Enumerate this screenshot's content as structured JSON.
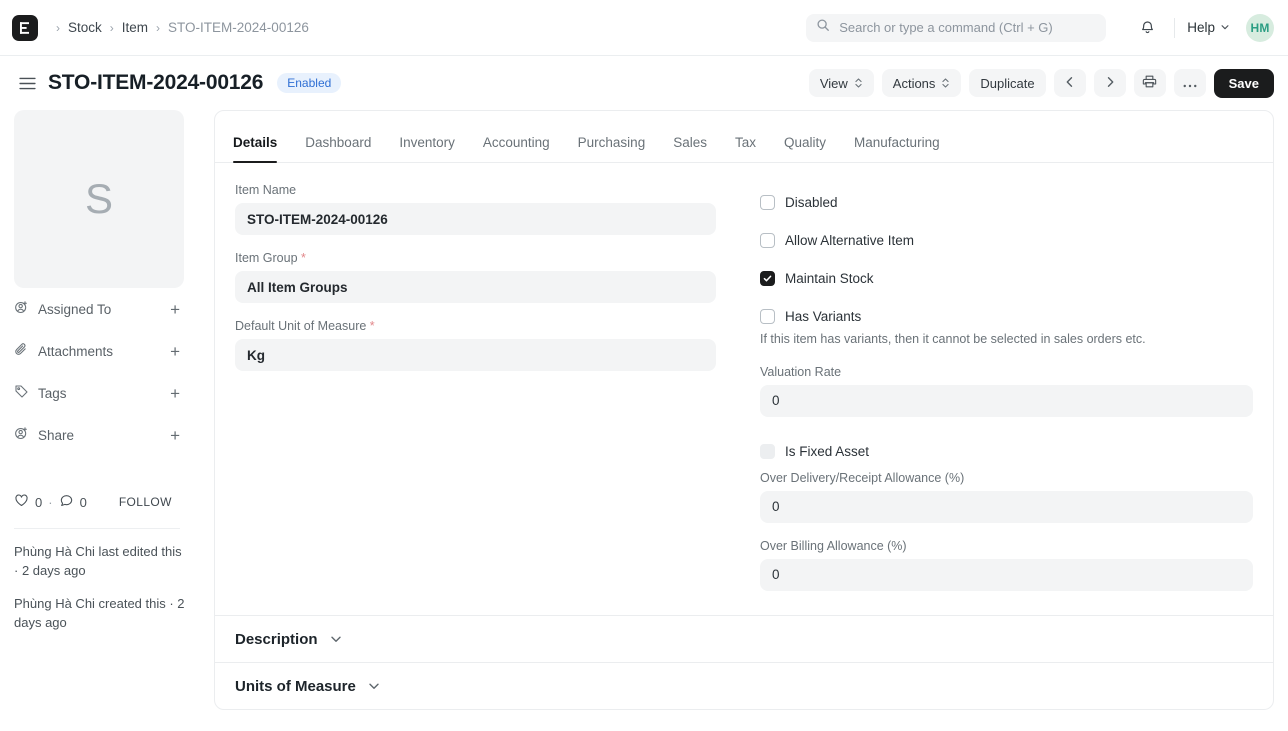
{
  "navbar": {
    "logo_icon": "erpnext-logo-icon",
    "breadcrumb": [
      {
        "label": "Stock",
        "current": false
      },
      {
        "label": "Item",
        "current": false
      },
      {
        "label": "STO-ITEM-2024-00126",
        "current": true
      }
    ],
    "search": {
      "placeholder": "Search or type a command (Ctrl + G)",
      "value": "",
      "icon": "search-icon"
    },
    "notifications_icon": "bell-icon",
    "help_label": "Help",
    "avatar_initials": "HM",
    "avatar_bg": "#d7ecdf",
    "avatar_fg": "#2b9e83"
  },
  "pagehead": {
    "menu_icon": "hamburger-icon",
    "title": "STO-ITEM-2024-00126",
    "status_badge": "Enabled",
    "badge_bg": "#e8f1fd",
    "badge_fg": "#2f6fd4",
    "actions": {
      "view": "View",
      "actions": "Actions",
      "duplicate": "Duplicate",
      "prev_icon": "chevron-left-icon",
      "next_icon": "chevron-right-icon",
      "print_icon": "printer-icon",
      "more_icon": "ellipsis-icon",
      "save": "Save"
    }
  },
  "sidebar": {
    "image_placeholder_letter": "S",
    "rows": [
      {
        "label": "Assigned To",
        "icon": "user-plus-icon",
        "add": "+"
      },
      {
        "label": "Attachments",
        "icon": "paperclip-icon",
        "add": "+"
      },
      {
        "label": "Tags",
        "icon": "tag-icon",
        "add": "+"
      },
      {
        "label": "Share",
        "icon": "user-plus-icon",
        "add": "+"
      }
    ],
    "stats": {
      "like_icon": "heart-icon",
      "like_count": "0",
      "separator": "·",
      "comment_icon": "comment-icon",
      "comment_count": "0",
      "follow": "FOLLOW"
    },
    "activity": [
      "Phùng Hà Chi last edited this · 2 days ago",
      "Phùng Hà Chi created this · 2 days ago"
    ]
  },
  "tabs": [
    {
      "label": "Details",
      "active": true
    },
    {
      "label": "Dashboard",
      "active": false
    },
    {
      "label": "Inventory",
      "active": false
    },
    {
      "label": "Accounting",
      "active": false
    },
    {
      "label": "Purchasing",
      "active": false
    },
    {
      "label": "Sales",
      "active": false
    },
    {
      "label": "Tax",
      "active": false
    },
    {
      "label": "Quality",
      "active": false
    },
    {
      "label": "Manufacturing",
      "active": false
    }
  ],
  "form": {
    "left": {
      "item_name": {
        "label": "Item Name",
        "value": "STO-ITEM-2024-00126",
        "required": false
      },
      "item_group": {
        "label": "Item Group",
        "value": "All Item Groups",
        "required": true,
        "req_mark": "*"
      },
      "default_uom": {
        "label": "Default Unit of Measure",
        "value": "Kg",
        "required": true,
        "req_mark": "*"
      }
    },
    "right": {
      "disabled_cb": {
        "label": "Disabled",
        "checked": false
      },
      "allow_alt_cb": {
        "label": "Allow Alternative Item",
        "checked": false
      },
      "maintain_stock_cb": {
        "label": "Maintain Stock",
        "checked": true
      },
      "has_variants_cb": {
        "label": "Has Variants",
        "checked": false
      },
      "variants_help": "If this item has variants, then it cannot be selected in sales orders etc.",
      "valuation_rate": {
        "label": "Valuation Rate",
        "value": "0"
      },
      "is_fixed_asset_cb": {
        "label": "Is Fixed Asset",
        "checked": false,
        "disabled": true
      },
      "over_delivery": {
        "label": "Over Delivery/Receipt Allowance (%)",
        "value": "0"
      },
      "over_billing": {
        "label": "Over Billing Allowance (%)",
        "value": "0"
      }
    }
  },
  "sections": [
    {
      "title": "Description",
      "icon": "chevron-down-icon"
    },
    {
      "title": "Units of Measure",
      "icon": "chevron-down-icon"
    }
  ]
}
